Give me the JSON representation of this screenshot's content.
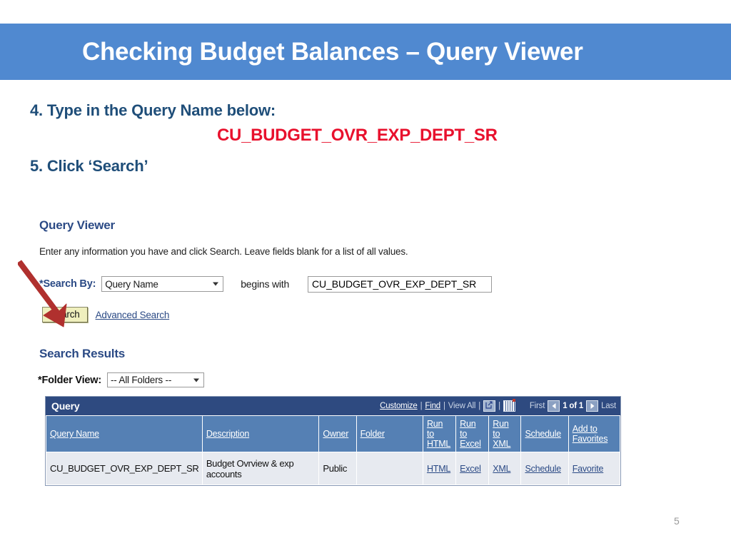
{
  "slide": {
    "title": "Checking Budget Balances – Query Viewer",
    "page_number": "5",
    "banner_color": "#5089D0",
    "heading_color": "#1F4E79",
    "accent_red": "#E8112D"
  },
  "instructions": {
    "step4": "4. Type in the Query Name below:",
    "query_name": "CU_BUDGET_OVR_EXP_DEPT_SR",
    "step5": "5. Click ‘Search’"
  },
  "query_viewer": {
    "title": "Query Viewer",
    "instruction": "Enter any information you have and click Search. Leave fields blank for a list of all values.",
    "search_by_label": "*Search By:",
    "search_by_value": "Query Name",
    "operator_label": "begins with",
    "search_value": "CU_BUDGET_OVR_EXP_DEPT_SR",
    "search_button": "Search",
    "advanced_search_link": "Advanced Search"
  },
  "search_results": {
    "title": "Search Results",
    "folder_view_label": "*Folder View:",
    "folder_view_value": "-- All Folders --"
  },
  "grid": {
    "title": "Query",
    "tools": {
      "customize": "Customize",
      "find": "Find",
      "view_all": "View All",
      "sep": "|",
      "download_icon": "download-to-excel-icon",
      "grid_icon": "spreadsheet-grid-icon"
    },
    "pager": {
      "first": "First",
      "prev_icon": "previous-page-arrow-icon",
      "count": "1 of 1",
      "next_icon": "next-page-arrow-icon",
      "last": "Last"
    },
    "columns": [
      "Query Name",
      "Description",
      "Owner",
      "Folder",
      "Run to HTML",
      "Run to Excel",
      "Run to XML",
      "Schedule",
      "Add to Favorites"
    ],
    "columns_split": {
      "run_html_1": "Run to",
      "run_html_2": "HTML",
      "run_excel_1": "Run to",
      "run_excel_2": "Excel",
      "run_xml_1": "Run to",
      "run_xml_2": "XML",
      "add_fav_1": "Add to",
      "add_fav_2": "Favorites"
    },
    "rows": [
      {
        "query_name": "CU_BUDGET_OVR_EXP_DEPT_SR",
        "description": "Budget Ovrview & exp accounts",
        "owner": "Public",
        "folder": "",
        "run_html": "HTML",
        "run_excel": "Excel",
        "run_xml": "XML",
        "schedule": "Schedule",
        "favorite": "Favorite"
      }
    ]
  },
  "annotation": {
    "arrow_icon": "red-pointer-arrow-icon",
    "arrow_color": "#B0302E",
    "points_to": "Search"
  }
}
